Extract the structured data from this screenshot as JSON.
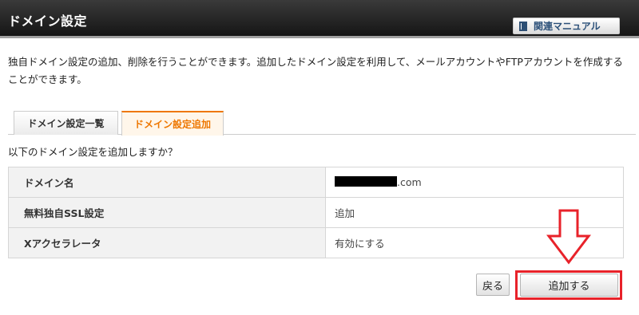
{
  "header": {
    "title": "ドメイン設定",
    "manual_button": "関連マニュアル",
    "manual_icon": "book-icon"
  },
  "description": "独自ドメイン設定の追加、削除を行うことができます。追加したドメイン設定を利用して、メールアカウントやFTPアカウントを作成することができます。",
  "tabs": [
    {
      "label": "ドメイン設定一覧",
      "active": false
    },
    {
      "label": "ドメイン設定追加",
      "active": true
    }
  ],
  "confirm_message": "以下のドメイン設定を追加しますか？",
  "table": {
    "rows": [
      {
        "label": "ドメイン名",
        "value": ".com",
        "redacted_prefix": true
      },
      {
        "label": "無料独自SSL設定",
        "value": "追加"
      },
      {
        "label": "Xアクセラレータ",
        "value": "有効にする"
      }
    ]
  },
  "buttons": {
    "back": "戻る",
    "add": "追加する"
  },
  "colors": {
    "accent": "#ee7700",
    "highlight": "#e8222a"
  }
}
